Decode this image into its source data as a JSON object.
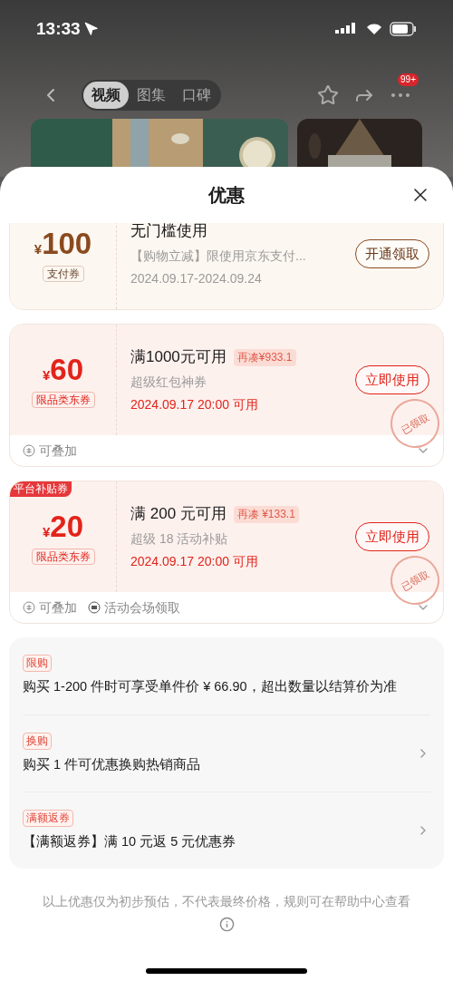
{
  "status_bar": {
    "time": "13:33"
  },
  "nav": {
    "tabs": [
      {
        "label": "视频",
        "selected": true
      },
      {
        "label": "图集",
        "selected": false
      },
      {
        "label": "口碑",
        "selected": false
      }
    ],
    "badge": "99+"
  },
  "sheet": {
    "title": "优惠"
  },
  "coupons": [
    {
      "kind": "payment",
      "currency": "¥",
      "amount": "100",
      "type": "支付券",
      "title": "无门槛使用",
      "desc": "【购物立减】限使用京东支付...",
      "date": "2024.09.17-2024.09.24",
      "button": "开通领取",
      "claimed": false
    },
    {
      "kind": "category",
      "currency": "¥",
      "amount": "60",
      "type": "限品类东券",
      "title": "满1000元可用",
      "gap": "再凑¥933.1",
      "desc": "超级红包神券",
      "date": "2024.09.17 20:00 可用",
      "button": "立即使用",
      "claimed": true,
      "stamp": "已领取",
      "footer": [
        {
          "kind": "stack",
          "label": "可叠加"
        }
      ]
    },
    {
      "kind": "category",
      "corner": "平台补贴券",
      "currency": "¥",
      "amount": "20",
      "type": "限品类东券",
      "title": "满 200 元可用",
      "gap": "再凑 ¥133.1",
      "desc": "超级 18 活动补贴",
      "date": "2024.09.17 20:00 可用",
      "button": "立即使用",
      "claimed": true,
      "stamp": "已领取",
      "footer": [
        {
          "kind": "stack",
          "label": "可叠加"
        },
        {
          "kind": "venue",
          "label": "活动会场领取"
        }
      ]
    }
  ],
  "promotions": [
    {
      "tag": "限购",
      "text": "购买 1-200 件时可享受单件价 ¥ 66.90，超出数量以结算价为准",
      "arrow": false
    },
    {
      "tag": "换购",
      "text": "购买 1 件可优惠换购热销商品",
      "arrow": true
    },
    {
      "tag": "满额返券",
      "text": "【满额返券】满 10 元返 5 元优惠券",
      "arrow": true
    }
  ],
  "note": "以上优惠仅为初步预估，不代表最终价格，规则可在帮助中心查看"
}
